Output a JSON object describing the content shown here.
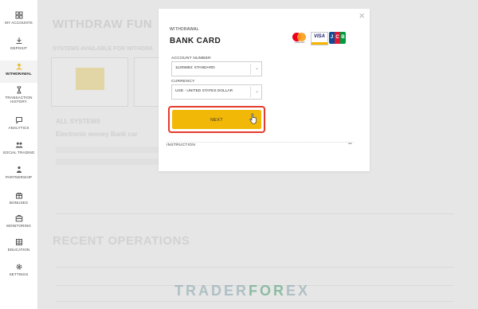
{
  "sidebar": {
    "items": [
      {
        "label": "MY ACCOUNTS",
        "icon": "grid-icon"
      },
      {
        "label": "DEPOSIT",
        "icon": "download-icon"
      },
      {
        "label": "WITHDRAWAL",
        "icon": "withdraw-icon",
        "active": true
      },
      {
        "label": "TRANSACTION HISTORY",
        "icon": "hourglass-icon"
      },
      {
        "label": "ANALYTICS",
        "icon": "chat-icon"
      },
      {
        "label": "SOCIAL TRADING",
        "icon": "people-icon"
      },
      {
        "label": "PARTNERSHIP",
        "icon": "partners-icon"
      },
      {
        "label": "BONUSES",
        "icon": "gift-icon"
      },
      {
        "label": "MONITORING",
        "icon": "briefcase-icon"
      },
      {
        "label": "EDUCATION",
        "icon": "book-icon"
      },
      {
        "label": "SETTINGS",
        "icon": "gear-icon"
      }
    ]
  },
  "background": {
    "title": "WITHDRAW FUN",
    "subtitle": "SYSTEMS AVAILABLE FOR WITHDRA",
    "all_systems": "ALL SYSTEMS",
    "tabs": "Electronic money     Bank car",
    "recent_operations": "RECENT OPERATIONS"
  },
  "modal": {
    "kicker": "WITHDRAWAL",
    "title": "BANK CARD",
    "account_number_label": "ACCOUNT NUMBER",
    "account_number_value": "11205983: STANDARD",
    "currency_label": "CURRENCY",
    "currency_value": "USD - UNITED STATES DOLLAR",
    "next_label": "NEXT",
    "instruction_label": "INSTRUCTION",
    "collapse_symbol": "−",
    "close_symbol": "×",
    "mastercard_text": "mastercard",
    "visa_text": "VISA",
    "jcb_letters": [
      "J",
      "C",
      "B"
    ],
    "colors": {
      "accent": "#f2b807",
      "highlight_border": "#e53b2c"
    }
  },
  "watermark": {
    "prefix": "TRADER",
    "middle": "FOR",
    "suffix": "EX"
  }
}
